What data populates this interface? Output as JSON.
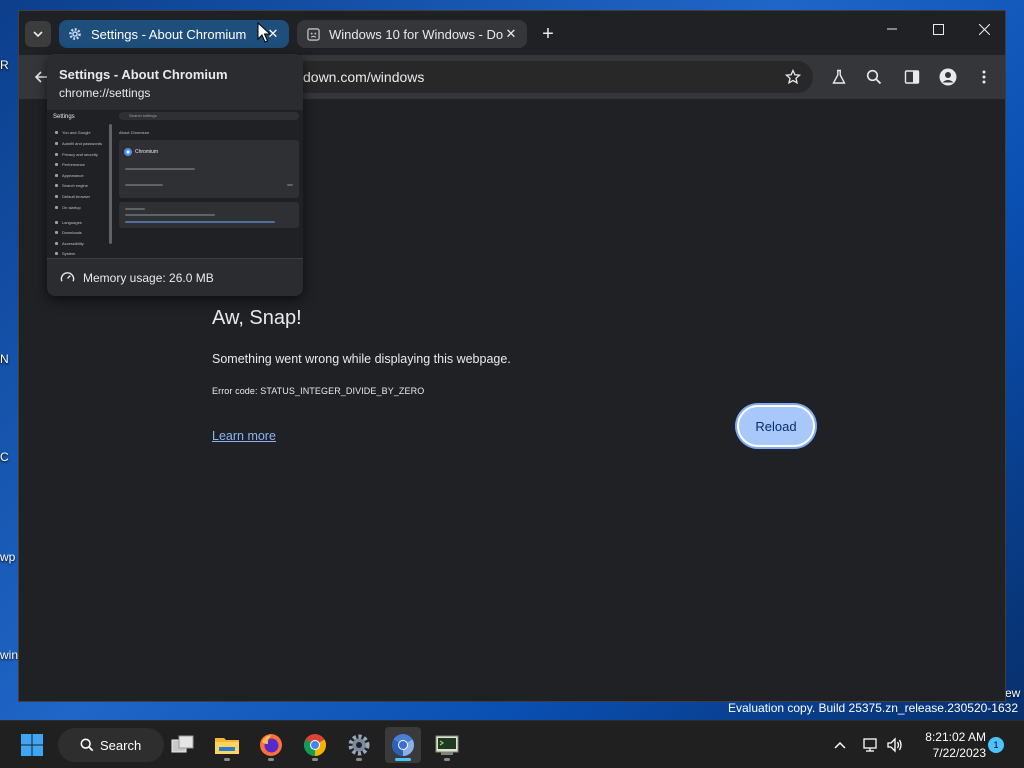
{
  "desktop": {
    "fragments": [
      "R",
      "N",
      "C",
      "wp",
      "win",
      "ew"
    ]
  },
  "tabs": [
    {
      "title": "Settings - About Chromium",
      "icon": "gear-icon",
      "active": true
    },
    {
      "title": "Windows 10 for Windows - Do",
      "icon": "page-icon",
      "active": false
    }
  ],
  "toolbar": {
    "url": "down.com/windows"
  },
  "hovercard": {
    "title": "Settings - About Chromium",
    "url": "chrome://settings",
    "memory": "Memory usage: 26.0 MB",
    "thumbnail": {
      "header": "Settings",
      "search": "Search settings",
      "items": [
        "You and Google",
        "Autofill and passwords",
        "Privacy and security",
        "Performance",
        "Appearance",
        "Search engine",
        "Default browser",
        "On startup",
        "Languages",
        "Downloads",
        "Accessibility",
        "System"
      ],
      "main_title": "About Chromium",
      "app_name": "Chromium"
    }
  },
  "error": {
    "title": "Aw, Snap!",
    "message": "Something went wrong while displaying this webpage.",
    "code": "Error code: STATUS_INTEGER_DIVIDE_BY_ZERO",
    "learn_more": "Learn more",
    "reload": "Reload"
  },
  "taskbar": {
    "search_label": "Search",
    "time": "8:21:02 AM",
    "date": "7/22/2023",
    "notifications": "1"
  },
  "watermark": "Evaluation copy. Build 25375.zn_release.230520-1632",
  "colors": {
    "accent": "#a8c7fa",
    "active_tab": "#1e4e7c",
    "link": "#8ab4f8"
  }
}
